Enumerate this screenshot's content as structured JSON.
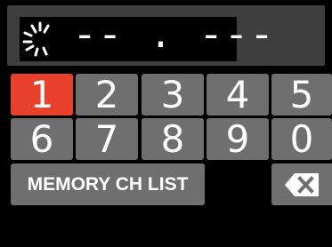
{
  "display": {
    "frequency": "-- . ---",
    "status_icon": "busy-spinner-icon"
  },
  "keypad": {
    "digits": [
      "1",
      "2",
      "3",
      "4",
      "5",
      "6",
      "7",
      "8",
      "9",
      "0"
    ],
    "selected": "1",
    "memory_label": "MEMORY CH LIST",
    "backspace_icon": "backspace-icon"
  },
  "colors": {
    "background": "#000000",
    "display_panel": "#3e3e3e",
    "key": "#6f6f6f",
    "key_active": "#e8402a",
    "text": "#ffffff"
  }
}
